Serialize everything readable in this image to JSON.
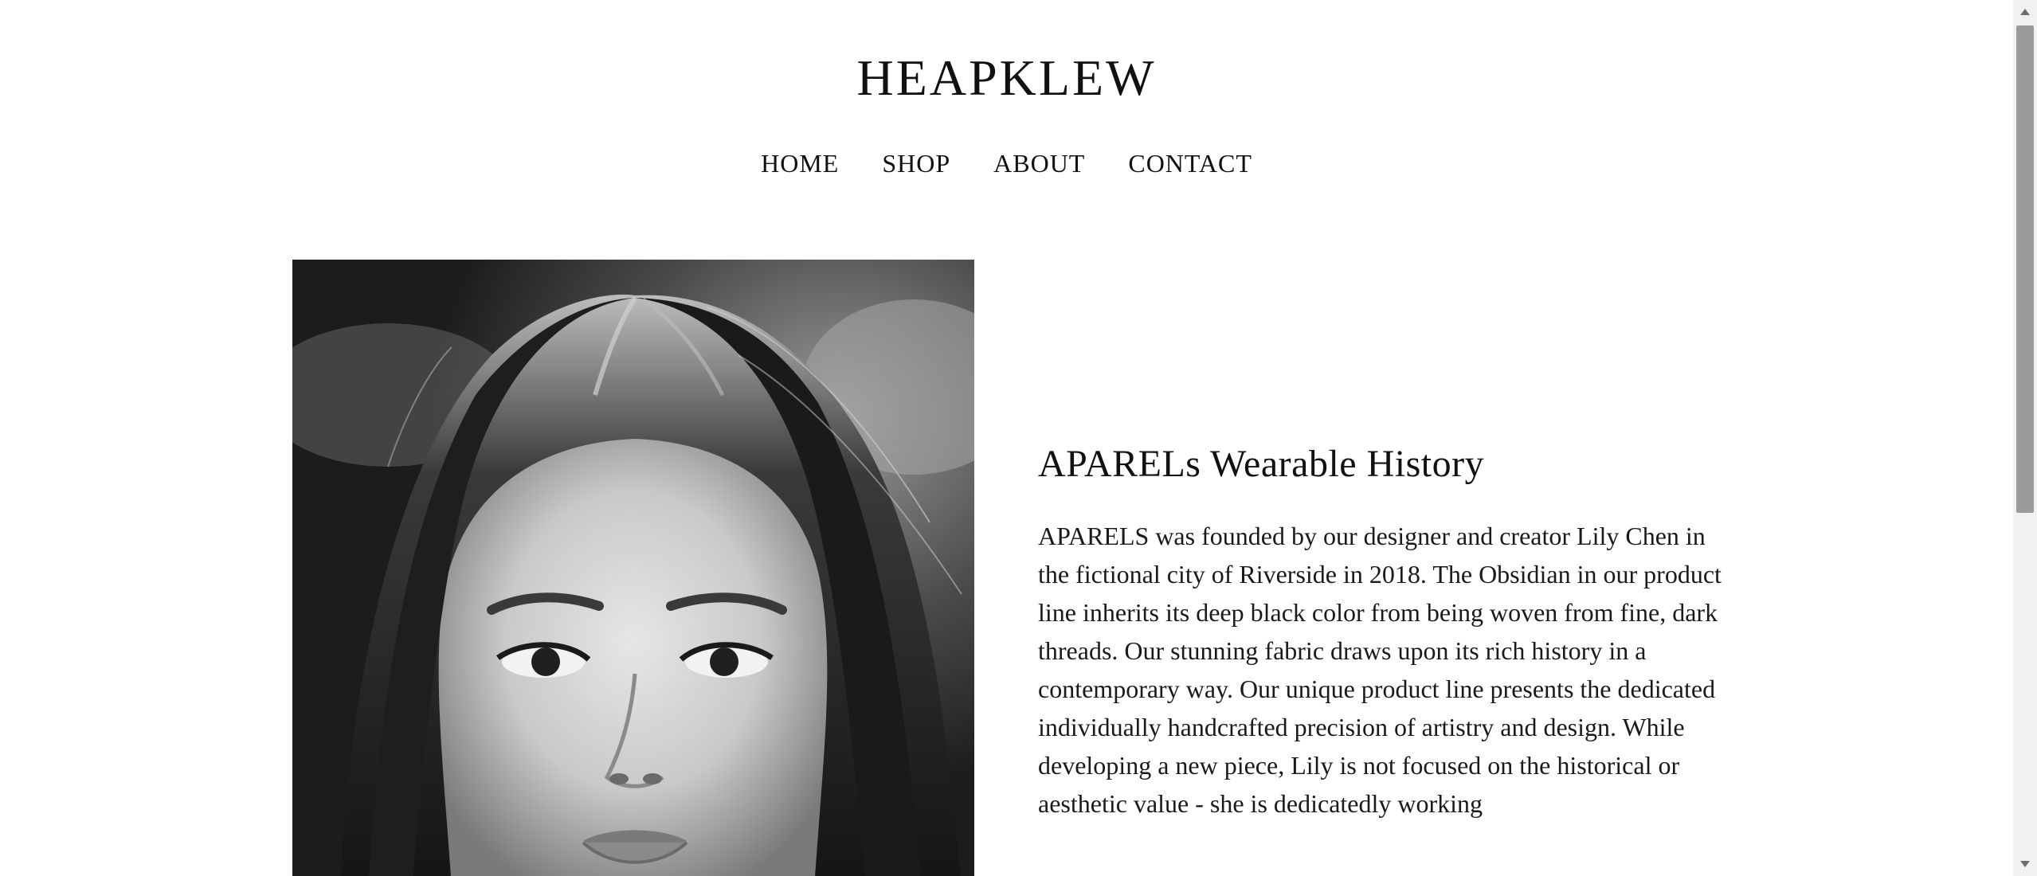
{
  "header": {
    "site_title": "HEAPKLEW"
  },
  "nav": {
    "items": [
      {
        "label": "HOME"
      },
      {
        "label": "SHOP"
      },
      {
        "label": "ABOUT"
      },
      {
        "label": "CONTACT"
      }
    ]
  },
  "main": {
    "image": {
      "alt": "Black and white portrait of a woman with long dark hair",
      "style": "grayscale"
    },
    "heading": "APARELs Wearable History",
    "paragraph": "APARELS was founded by our designer and creator Lily Chen in the fictional city of Riverside in 2018. The Obsidian in our product line inherits its deep black color from being woven from fine, dark threads. Our stunning fabric draws upon its rich history in a contemporary way. Our unique product line presents the dedicated individually handcrafted precision of artistry and design. While developing a new piece, Lily is not focused on the historical or aesthetic value - she is dedicatedly working"
  },
  "scrollbar": {
    "up_icon": "triangle-up-icon",
    "down_icon": "triangle-down-icon"
  },
  "colors": {
    "background": "#ffffff",
    "text": "#111111",
    "scrollbar_track": "#f1f1f1",
    "scrollbar_thumb": "#9b9b9b"
  }
}
